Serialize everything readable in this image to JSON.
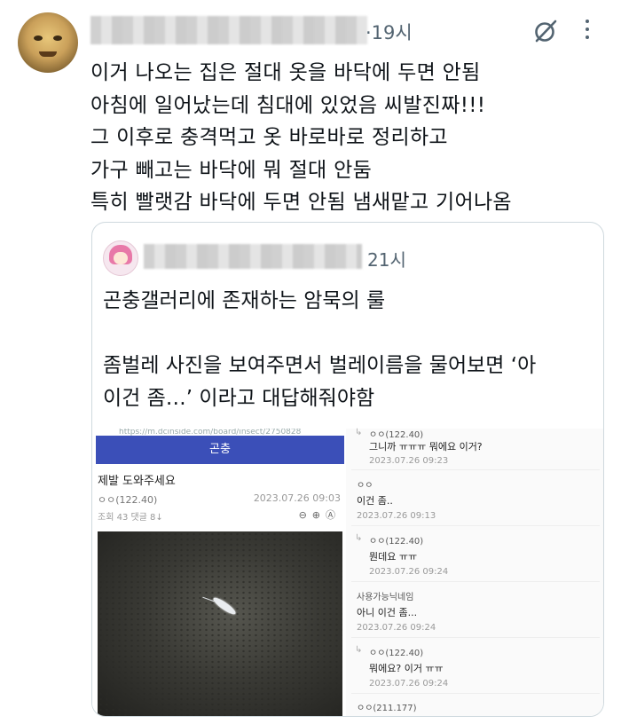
{
  "tweet": {
    "time": "·19시",
    "lines": [
      "이거 나오는 집은 절대 옷을 바닥에 두면 안됨",
      "아침에 일어났는데 침대에 있었음 씨발진짜!!!",
      "그 이후로 충격먹고 옷 바로바로 정리하고",
      "가구 빼고는 바닥에 뭐 절대 안둠",
      "특히 빨랫감 바닥에 두면 안됨 냄새맡고 기어나옴"
    ]
  },
  "icons": {
    "grok": "grok-slash-circle-icon",
    "more": "more-vertical-icon"
  },
  "quote": {
    "time": "21시",
    "lines": [
      "곤충갤러리에 존재하는 암묵의 룰",
      "",
      "좀벌레 사진을 보여주면서 벌레이름을 물어보면 ‘아",
      "이건 좀…’ 이라고 대답해줘야함"
    ]
  },
  "screenshot": {
    "url": "https://m.dcinside.com/board/insect/2750828",
    "banner": "곤충",
    "post_title": "제발 도와주세요",
    "post_author": "ㅇㅇ(122.40)",
    "post_date": "2023.07.26 09:03",
    "post_stats": "조회 43  댓글 8↓",
    "post_tools": "⊖⊕Ⓐ",
    "comments": [
      {
        "reply": true,
        "nick": "ㅇㅇ(122.40)",
        "text": "그니까 ㅠㅠㅠ 뭐에요 이거?",
        "date": "2023.07.26 09:23"
      },
      {
        "reply": false,
        "nick": "ㅇㅇ",
        "text": "이건 좀..",
        "date": "2023.07.26 09:13"
      },
      {
        "reply": true,
        "nick": "ㅇㅇ(122.40)",
        "text": "뭔데요 ㅠㅠ",
        "date": "2023.07.26 09:24"
      },
      {
        "reply": false,
        "nick": "사용가능닉네임",
        "text": "아니 이건 좀...",
        "date": "2023.07.26 09:24"
      },
      {
        "reply": true,
        "nick": "ㅇㅇ(122.40)",
        "text": "뭐에요? 이거 ㅠㅠ",
        "date": "2023.07.26 09:24"
      },
      {
        "reply": false,
        "nick": "ㅇㅇ(211.177)",
        "text": "",
        "date": ""
      }
    ]
  }
}
